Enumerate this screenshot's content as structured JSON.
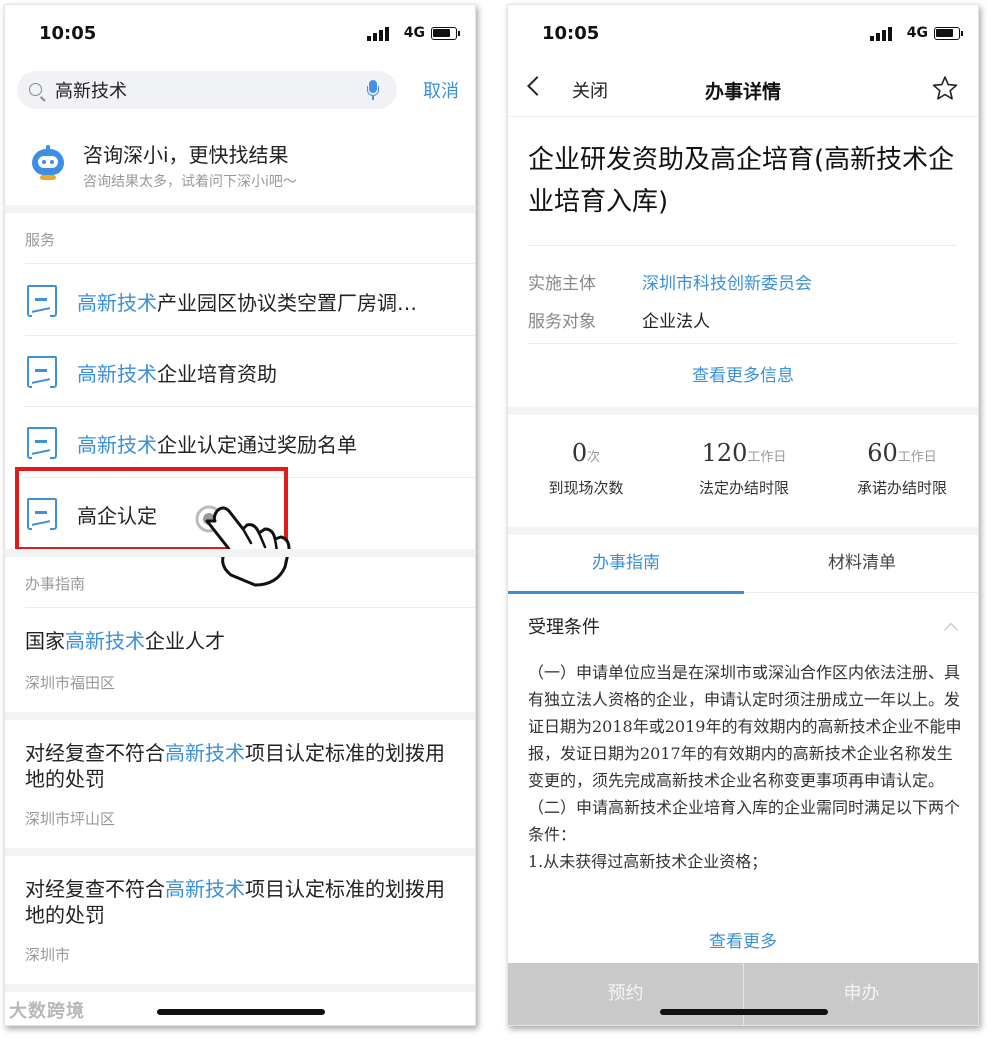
{
  "left": {
    "status": {
      "time": "10:05",
      "network": "4G"
    },
    "search": {
      "value": "高新技术",
      "cancel_label": "取消"
    },
    "ai_prompt": {
      "title": "咨询深小i，更快找结果",
      "subtitle": "咨询结果太多，试着问下深小i吧～"
    },
    "services": {
      "section_label": "服务",
      "items": [
        {
          "highlight": "高新技术",
          "rest": "产业园区协议类空置厂房调…"
        },
        {
          "highlight": "高新技术",
          "rest": "企业培育资助"
        },
        {
          "highlight": "高新技术",
          "rest": "企业认定通过奖励名单"
        },
        {
          "highlight": "",
          "rest": "高企认定"
        }
      ]
    },
    "guides": {
      "section_label": "办事指南",
      "items": [
        {
          "pre": "国家",
          "highlight": "高新技术",
          "post": "企业人才",
          "area": "深圳市福田区"
        },
        {
          "pre": "对经复查不符合",
          "highlight": "高新技术",
          "post": "项目认定标准的划拨用地的处罚",
          "area": "深圳市坪山区"
        },
        {
          "pre": "对经复查不符合",
          "highlight": "高新技术",
          "post": "项目认定标准的划拨用地的处罚",
          "area": "深圳市"
        }
      ]
    },
    "watermark": "大数跨境"
  },
  "right": {
    "status": {
      "time": "10:05",
      "network": "4G"
    },
    "nav": {
      "close_label": "关闭",
      "title": "办事详情"
    },
    "item_title": "企业研发资助及高企培育(高新技术企业培育入库)",
    "info": {
      "implementer_label": "实施主体",
      "implementer_value": "深圳市科技创新委员会",
      "target_label": "服务对象",
      "target_value": "企业法人",
      "more_info": "查看更多信息"
    },
    "stats": [
      {
        "value": "0",
        "unit": "次",
        "label": "到现场次数"
      },
      {
        "value": "120",
        "unit": "工作日",
        "label": "法定办结时限"
      },
      {
        "value": "60",
        "unit": "工作日",
        "label": "承诺办结时限"
      }
    ],
    "tabs": [
      {
        "label": "办事指南"
      },
      {
        "label": "材料清单"
      }
    ],
    "conditions": {
      "title": "受理条件",
      "para1": "（一）申请单位应当是在深圳市或深汕合作区内依法注册、具有独立法人资格的企业，申请认定时须注册成立一年以上。发证日期为2018年或2019年的有效期内的高新技术企业不能申报，发证日期为2017年的有效期内的高新技术企业名称发生变更的，须先完成高新技术企业名称变更事项再申请认定。",
      "para2": "（二）申请高新技术企业培育入库的企业需同时满足以下两个条件：",
      "para3": "1.从未获得过高新技术企业资格；",
      "see_more": "查看更多"
    },
    "bottom": {
      "reserve_label": "预约",
      "apply_label": "申办"
    }
  },
  "colors": {
    "accent": "#3b8fd9",
    "highlight_box": "#e11b1b",
    "bottom_bar": "#c9c9c9"
  }
}
